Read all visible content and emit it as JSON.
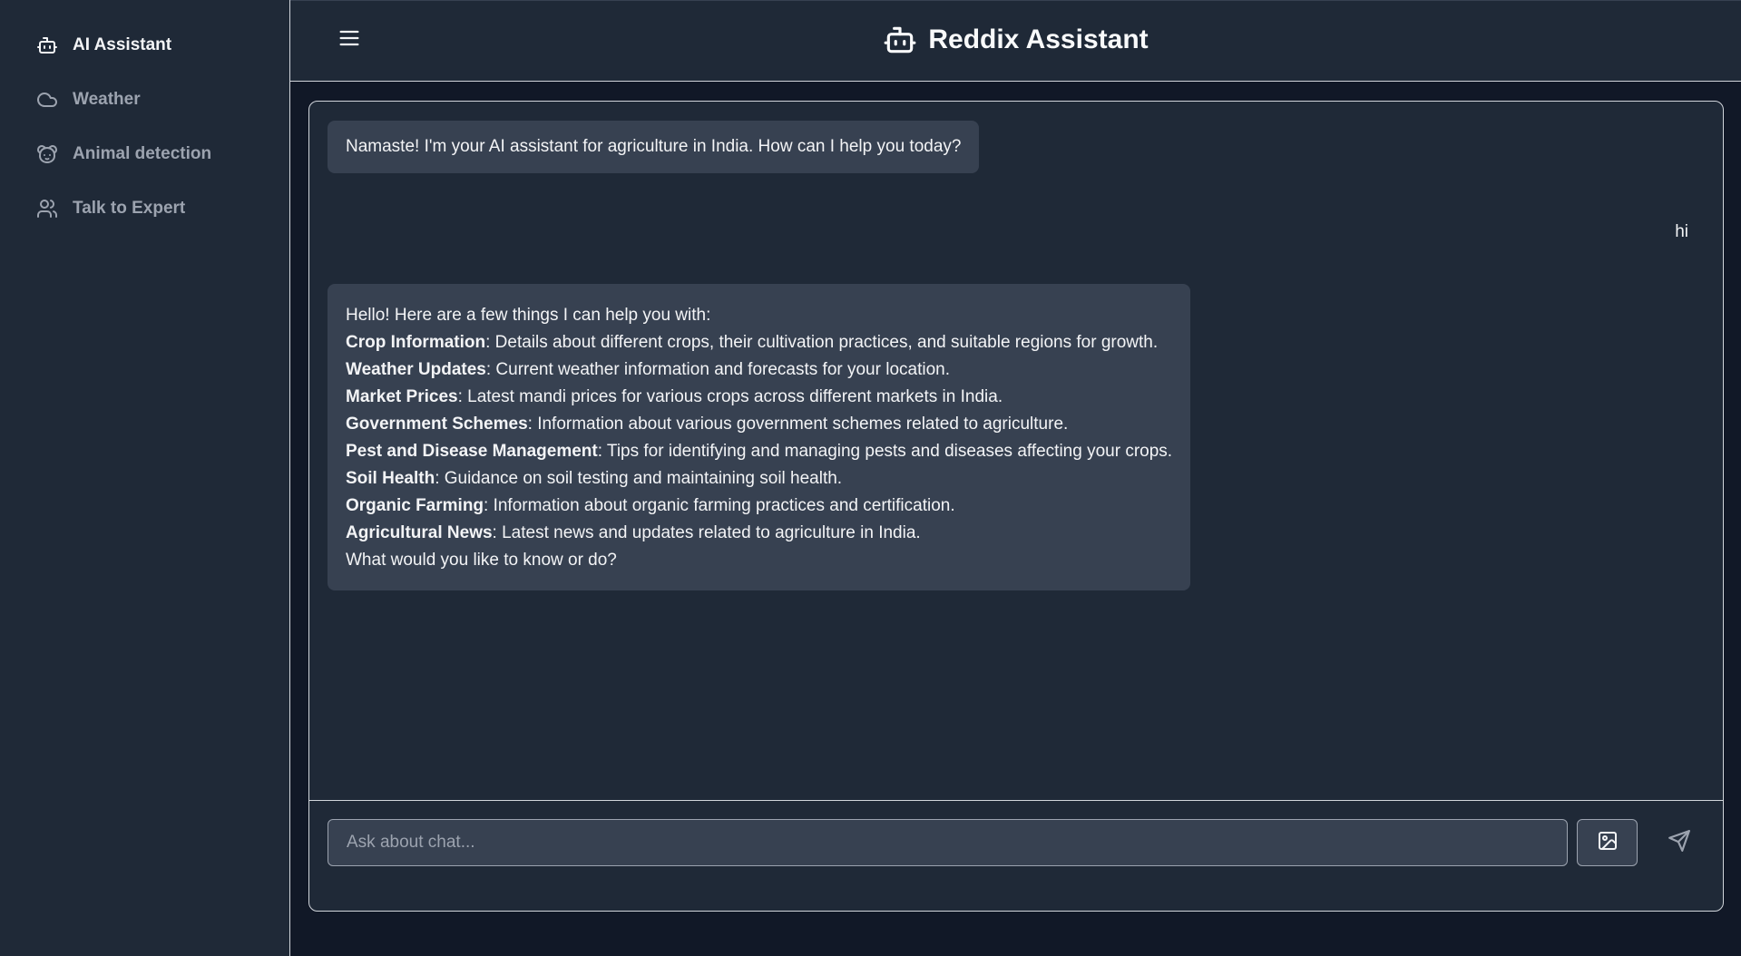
{
  "sidebar": {
    "items": [
      {
        "label": "AI Assistant",
        "icon": "bot-icon",
        "active": true
      },
      {
        "label": "Weather",
        "icon": "cloud-icon",
        "active": false
      },
      {
        "label": "Animal detection",
        "icon": "animal-icon",
        "active": false
      },
      {
        "label": "Talk to Expert",
        "icon": "users-icon",
        "active": false
      }
    ]
  },
  "header": {
    "title": "Reddix Assistant",
    "menu_icon": "menu-icon",
    "brand_icon": "bot-icon"
  },
  "chat": {
    "greeting": "Namaste! I'm your AI assistant for agriculture in India. How can I help you today?",
    "user_message": "hi",
    "reply": {
      "intro": "Hello! Here are a few things I can help you with:",
      "items": [
        {
          "title": "Crop Information",
          "text": ": Details about different crops, their cultivation practices, and suitable regions for growth."
        },
        {
          "title": "Weather Updates",
          "text": ": Current weather information and forecasts for your location."
        },
        {
          "title": "Market Prices",
          "text": ": Latest mandi prices for various crops across different markets in India."
        },
        {
          "title": "Government Schemes",
          "text": ": Information about various government schemes related to agriculture."
        },
        {
          "title": "Pest and Disease Management",
          "text": ": Tips for identifying and managing pests and diseases affecting your crops."
        },
        {
          "title": "Soil Health",
          "text": ": Guidance on soil testing and maintaining soil health."
        },
        {
          "title": "Organic Farming",
          "text": ": Information about organic farming practices and certification."
        },
        {
          "title": "Agricultural News",
          "text": ": Latest news and updates related to agriculture in India."
        }
      ],
      "outro": "What would you like to know or do?"
    }
  },
  "composer": {
    "placeholder": "Ask about chat...",
    "value": "",
    "image_icon": "image-icon",
    "send_icon": "send-icon"
  },
  "colors": {
    "sidebar_bg": "#1f2937",
    "page_bg": "#111827",
    "bubble_bg": "#374151",
    "border": "#d1d5db",
    "muted_text": "#9ca3af"
  }
}
